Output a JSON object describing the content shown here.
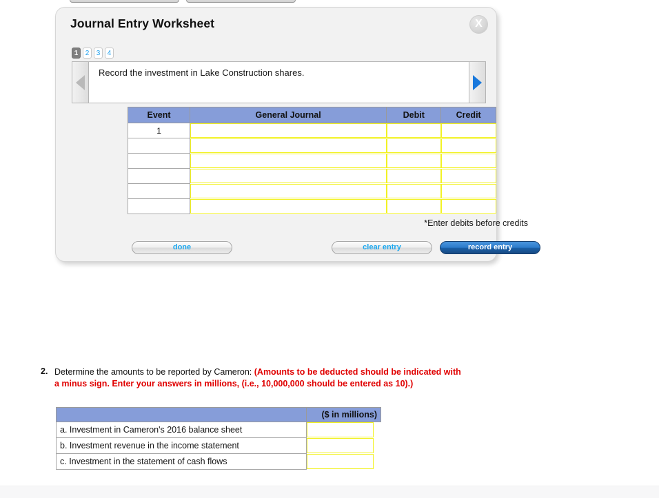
{
  "top_stubs": [
    {
      "name": "cut-off-toolbar-button-left"
    },
    {
      "name": "cut-off-toolbar-button-right"
    }
  ],
  "worksheet": {
    "title": "Journal Entry Worksheet",
    "close_label": "X",
    "steps": [
      {
        "label": "1",
        "active": true
      },
      {
        "label": "2",
        "active": false
      },
      {
        "label": "3",
        "active": false
      },
      {
        "label": "4",
        "active": false
      }
    ],
    "prompt": "Record the investment in Lake Construction shares.",
    "nav": {
      "prev_icon": "triangle-left-icon",
      "next_icon": "triangle-right-icon"
    },
    "table": {
      "headers": [
        "Event",
        "General Journal",
        "Debit",
        "Credit"
      ],
      "rows": [
        {
          "event": "1",
          "general_journal": "",
          "debit": "",
          "credit": ""
        },
        {
          "event": "",
          "general_journal": "",
          "debit": "",
          "credit": ""
        },
        {
          "event": "",
          "general_journal": "",
          "debit": "",
          "credit": ""
        },
        {
          "event": "",
          "general_journal": "",
          "debit": "",
          "credit": ""
        },
        {
          "event": "",
          "general_journal": "",
          "debit": "",
          "credit": ""
        },
        {
          "event": "",
          "general_journal": "",
          "debit": "",
          "credit": ""
        }
      ]
    },
    "note": "*Enter debits before credits",
    "buttons": {
      "done": "done",
      "clear_entry": "clear entry",
      "record_entry": "record entry"
    }
  },
  "question": {
    "number": "2.",
    "lead": "Determine the amounts to be reported by Cameron:",
    "emphasis": "(Amounts to be deducted should be indicated with a minus sign. Enter your answers in millions, (i.e., 10,000,000 should be entered as 10).)"
  },
  "amounts_table": {
    "header_blank": "",
    "header_units": "($ in millions)",
    "rows": [
      {
        "label": "a. Investment in Cameron's 2016 balance sheet",
        "value": ""
      },
      {
        "label": "b. Investment revenue in the income statement",
        "value": ""
      },
      {
        "label": "c. Investment in the statement of cash flows",
        "value": ""
      }
    ]
  },
  "colors": {
    "table_header_blue": "#869dd9",
    "input_border_yellow": "#f2f224",
    "emphasis_red": "#e00000",
    "link_blue": "#1aa7ef",
    "record_button_blue": "#2d7ccb",
    "panel_background": "#f2f2f2"
  }
}
